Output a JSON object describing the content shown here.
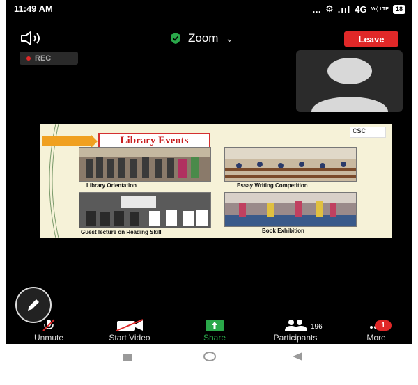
{
  "status_bar": {
    "time": "11:49 AM",
    "network": "4G",
    "network_label": "Vo) LTE",
    "battery": "18"
  },
  "header": {
    "title": "Zoom",
    "leave_label": "Leave",
    "rec_label": "REC"
  },
  "slide": {
    "title": "Library Events",
    "logo_text": "CSC",
    "captions": [
      "Library Orientation",
      "Essay Writing Competition",
      "Guest lecture on Reading Skill",
      "Book Exhibition"
    ]
  },
  "toolbar": {
    "unmute_label": "Unmute",
    "start_video_label": "Start Video",
    "share_label": "Share",
    "participants_label": "Participants",
    "participants_count": "196",
    "more_label": "More",
    "more_badge": "1"
  },
  "colors": {
    "leave": "#e02828",
    "share": "#2aa84a",
    "shield": "#2aa84a",
    "slide_title": "#c81e1e"
  },
  "icons": [
    "speaker-icon",
    "shield-icon",
    "chevron-down-icon",
    "pen-icon",
    "mic-muted-icon",
    "video-off-icon",
    "share-arrow-icon",
    "participants-icon",
    "more-icon"
  ]
}
